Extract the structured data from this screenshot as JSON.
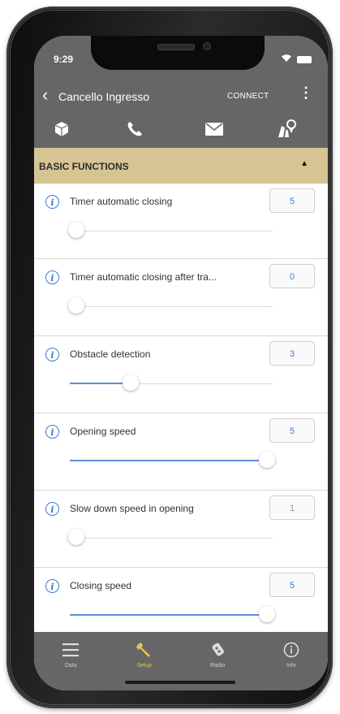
{
  "status_bar": {
    "time": "9:29"
  },
  "app_bar": {
    "title": "Cancello Ingresso",
    "connect_label": "CONNECT"
  },
  "icon_bar": {
    "icons": [
      "box-icon",
      "phone-icon",
      "mail-icon",
      "map-pin-icon"
    ]
  },
  "section": {
    "title": "BASIC FUNCTIONS"
  },
  "settings": [
    {
      "label": "Timer automatic closing",
      "value": "5",
      "level": 0.03
    },
    {
      "label": "Timer automatic closing after tra...",
      "value": "0",
      "level": 0.03
    },
    {
      "label": "Obstacle detection",
      "value": "3",
      "level": 0.3
    },
    {
      "label": "Opening speed",
      "value": "5",
      "level": 0.97
    },
    {
      "label": "Slow down speed in opening",
      "value": "1",
      "level": 0.03
    },
    {
      "label": "Closing speed",
      "value": "5",
      "level": 0.97
    }
  ],
  "tabs": [
    {
      "label": "Data",
      "icon": "list-icon",
      "active": false
    },
    {
      "label": "Setup",
      "icon": "wrench-icon",
      "active": true
    },
    {
      "label": "Radio",
      "icon": "remote-icon",
      "active": false
    },
    {
      "label": "Info",
      "icon": "info-icon",
      "active": false
    }
  ],
  "colors": {
    "header_gray": "#666666",
    "section_tan": "#d7c493",
    "accent_blue": "#3b7bd1",
    "active_tab": "#e0c35a"
  }
}
